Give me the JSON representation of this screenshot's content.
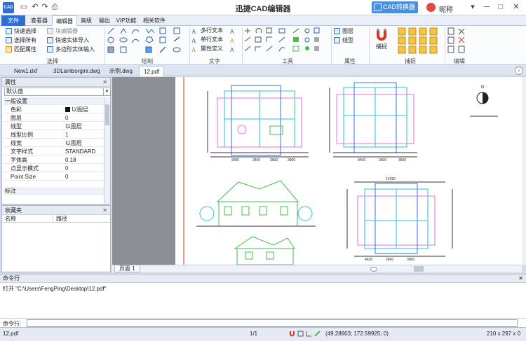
{
  "titlebar": {
    "logo": "CAD",
    "title": "迅捷CAD编辑器",
    "convert_button": "CAD转换器",
    "username": "昵称",
    "logo_icon": "cad-logo-icon",
    "save_icon": "save-icon",
    "undo_icon": "undo-icon",
    "redo_icon": "redo-icon",
    "print_icon": "print-icon"
  },
  "menu": {
    "tabs": [
      "文件",
      "查看器",
      "编辑器",
      "高级",
      "输出",
      "VIP功能",
      "相关软件"
    ],
    "active": "编辑器"
  },
  "ribbon": {
    "select": {
      "label": "选择",
      "quick_select": "快速选择",
      "select_all": "选择所有",
      "match_props": "匹配属性",
      "block_editor": "块编辑器",
      "quick_solid": "快速实体导入",
      "polygon_solid": "多边形实体输入"
    },
    "draw": {
      "label": "绘制"
    },
    "text": {
      "label": "文字",
      "mtext": "多行文本",
      "stext": "单行文本",
      "attdef": "属性定义"
    },
    "tools": {
      "label": "工具"
    },
    "props": {
      "label": "属性",
      "layer": "图层",
      "linetype": "线型"
    },
    "snap": {
      "label": "捕捉",
      "snap_button": "捕捉"
    },
    "edit": {
      "label": "编辑"
    }
  },
  "doc_tabs": [
    "New1.dxf",
    "3DLamborgini.dwg",
    "示例.dwg",
    "12.pdf"
  ],
  "active_doc": "12.pdf",
  "properties": {
    "title": "属性",
    "default_value": "默认值",
    "section_general": "一般设置",
    "rows": [
      {
        "k": "色彩",
        "v": "以图层"
      },
      {
        "k": "图层",
        "v": "0"
      },
      {
        "k": "线型",
        "v": "以图层"
      },
      {
        "k": "线型比例",
        "v": "1"
      },
      {
        "k": "线宽",
        "v": "以图层"
      },
      {
        "k": "文字样式",
        "v": "STANDARD"
      },
      {
        "k": "字体高",
        "v": "0.18"
      },
      {
        "k": "点显示模式",
        "v": "0"
      },
      {
        "k": "Point Size",
        "v": "0"
      }
    ],
    "section_annotation": "标注"
  },
  "favorites": {
    "title": "收藏夹",
    "col_name": "名称",
    "col_path": "路径"
  },
  "page_tab": "页面 1",
  "drawing": {
    "dims_top_left": [
      "9000",
      "2400",
      "3600",
      "3900"
    ],
    "dims_top_right": [
      "8400",
      "3600",
      "3600"
    ],
    "dims_bottom": [
      "4620",
      "2400",
      "3600"
    ],
    "dims_bottom_right_top": "14290",
    "compass_n": "N"
  },
  "command": {
    "title": "命令行",
    "output": "打开 \"C:\\Users\\FengPing\\Desktop\\12.pdf\"",
    "input_label": "命令行:"
  },
  "status": {
    "file": "12.pdf",
    "page": "1/1",
    "coords": "(49.28903; 172.59925; 0)",
    "size": "210 x 297 x 0"
  },
  "colors": {
    "accent": "#2f6fd1",
    "convert": "#4a8fe0",
    "cad_cyan": "#27c3d8",
    "cad_magenta": "#e373e8",
    "cad_green": "#3ec24e",
    "cad_blue": "#3b6fe0"
  }
}
